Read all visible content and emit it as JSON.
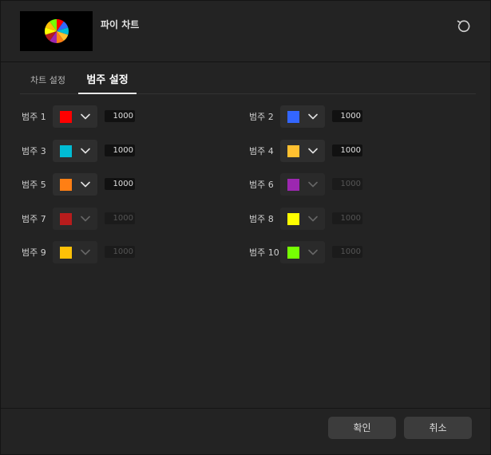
{
  "header": {
    "title": "파이 차트"
  },
  "tabs": [
    {
      "label": "차트 설정"
    },
    {
      "label": "범주 설정"
    }
  ],
  "legend_items": [
    {
      "label": "범주 1",
      "color": "#ff0000",
      "value": "1000",
      "enabled": true
    },
    {
      "label": "범주 2",
      "color": "#3366ff",
      "value": "1000",
      "enabled": true
    },
    {
      "label": "범주 3",
      "color": "#00bcd4",
      "value": "1000",
      "enabled": true
    },
    {
      "label": "범주 4",
      "color": "#ffc030",
      "value": "1000",
      "enabled": true
    },
    {
      "label": "범주 5",
      "color": "#ff7f14",
      "value": "1000",
      "enabled": true
    },
    {
      "label": "범주 6",
      "color": "#9c27b0",
      "value": "1000",
      "enabled": false
    },
    {
      "label": "범주 7",
      "color": "#b71c1c",
      "value": "1000",
      "enabled": false
    },
    {
      "label": "범주 8",
      "color": "#ffff00",
      "value": "1000",
      "enabled": false
    },
    {
      "label": "범주 9",
      "color": "#ffc107",
      "value": "1000",
      "enabled": false
    },
    {
      "label": "범주 10",
      "color": "#76ff03",
      "value": "1000",
      "enabled": false
    }
  ],
  "buttons": {
    "ok": "확인",
    "cancel": "취소"
  }
}
